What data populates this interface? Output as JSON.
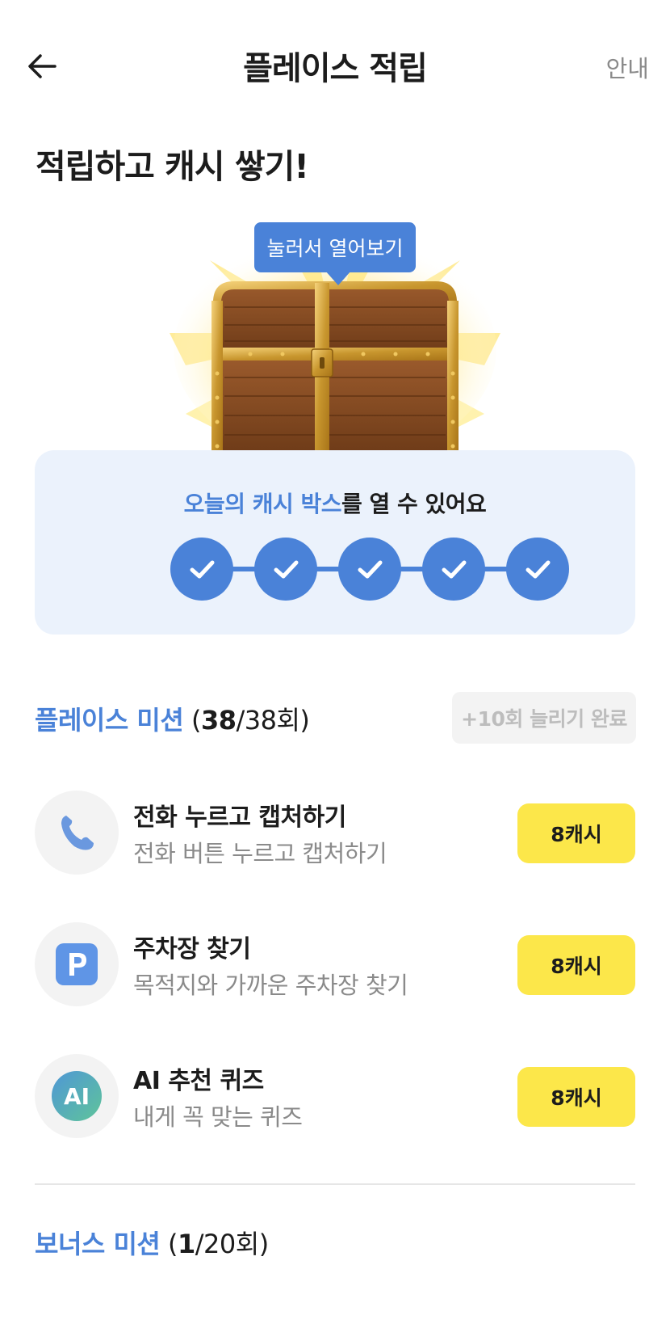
{
  "header": {
    "title": "플레이스 적립",
    "guide_label": "안내",
    "back_icon": "arrow-left-icon"
  },
  "hero": {
    "title": "적립하고 캐시 쌓기!",
    "tooltip": "눌러서 열어보기",
    "chest_icon": "treasure-chest-icon"
  },
  "progress": {
    "highlight": "오늘의 캐시 박스",
    "rest": "를 열 수 있어요",
    "completed": 5,
    "total": 5,
    "accent": "#4a82d8"
  },
  "place_mission": {
    "name": "플레이스 미션",
    "open": " (",
    "done": "38",
    "total_text": "/38회)",
    "badge": "+10회 늘리기 완료"
  },
  "missions": [
    {
      "title": "전화 누르고 캡처하기",
      "subtitle": "전화 버튼 누르고 캡처하기",
      "reward": "8캐시",
      "icon": "phone-icon"
    },
    {
      "title": "주차장 찾기",
      "subtitle": "목적지와 가까운 주차장 찾기",
      "reward": "8캐시",
      "icon": "parking-icon"
    },
    {
      "title": "AI 추천 퀴즈",
      "subtitle": "내게 꼭 맞는 퀴즈",
      "reward": "8캐시",
      "icon": "ai-icon"
    }
  ],
  "bonus_mission": {
    "name": "보너스 미션",
    "open": " (",
    "done": "1",
    "total_text": "/20회)"
  },
  "colors": {
    "accent": "#4a82d8",
    "reward_yellow": "#fce74a",
    "card_bg": "#ebf2fc"
  }
}
